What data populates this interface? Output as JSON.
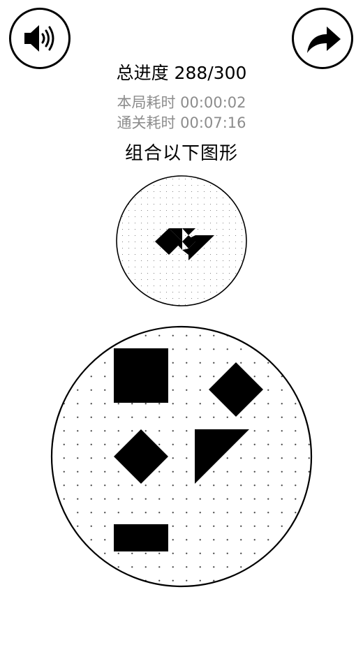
{
  "header": {
    "sound_button": {
      "icon": "speaker-volume-icon"
    },
    "share_button": {
      "icon": "share-arrow-icon"
    }
  },
  "progress": {
    "label": "总进度",
    "value": "288/300"
  },
  "timers": {
    "round_label": "本局耗时",
    "round_value": "00:00:02",
    "total_label": "通关耗时",
    "total_value": "00:07:16"
  },
  "instruction": "组合以下图形",
  "colors": {
    "background": "#ffffff",
    "ink": "#000000",
    "secondary_text": "#8c8c8c",
    "grid_dot": "#555555"
  },
  "target_board": {
    "description": "target-silhouette"
  },
  "piece_board": {
    "pieces": [
      {
        "name": "square-piece",
        "shape": "square"
      },
      {
        "name": "diamond-piece-right",
        "shape": "diamond"
      },
      {
        "name": "diamond-piece-left",
        "shape": "diamond"
      },
      {
        "name": "triangle-piece",
        "shape": "right-triangle"
      },
      {
        "name": "rectangle-piece",
        "shape": "rectangle"
      }
    ]
  }
}
